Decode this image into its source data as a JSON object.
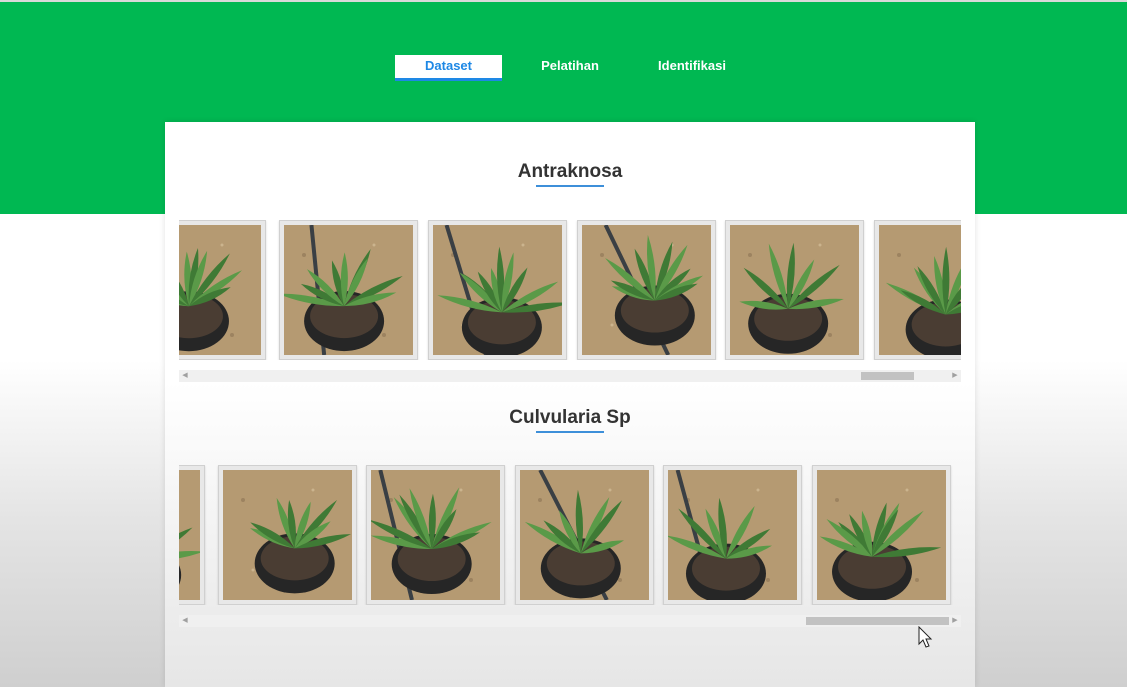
{
  "nav": {
    "tabs": [
      {
        "label": "Dataset",
        "active": true
      },
      {
        "label": "Pelatihan",
        "active": false
      },
      {
        "label": "Identifikasi",
        "active": false
      }
    ]
  },
  "sections": [
    {
      "title": "Antraknosa",
      "scroll_position": 0.87
    },
    {
      "title": "Culvularia Sp",
      "scroll_position": 0.99
    }
  ],
  "colors": {
    "header_green": "#00b852",
    "accent_blue": "#1e88e5",
    "soil": "#b59a72",
    "leaf": "#3f7a35",
    "pot": "#262626"
  },
  "icons": {
    "scroll_left": "chevron-left-icon",
    "scroll_right": "chevron-right-icon",
    "cursor": "mouse-pointer-icon"
  }
}
